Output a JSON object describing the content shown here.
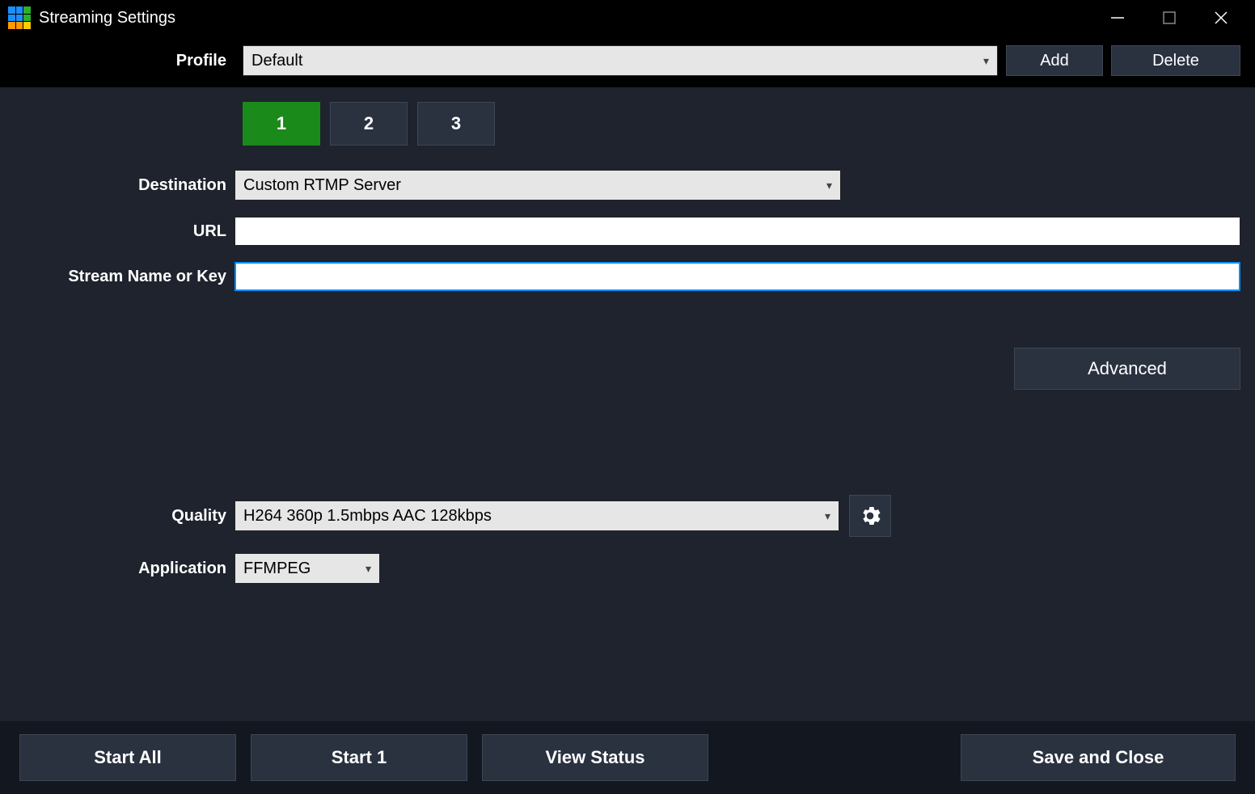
{
  "window": {
    "title": "Streaming Settings"
  },
  "profile": {
    "label": "Profile",
    "value": "Default",
    "add": "Add",
    "delete": "Delete"
  },
  "tabs": [
    "1",
    "2",
    "3"
  ],
  "destination": {
    "label": "Destination",
    "value": "Custom RTMP Server"
  },
  "url": {
    "label": "URL",
    "value": ""
  },
  "streamkey": {
    "label": "Stream Name or Key",
    "value": ""
  },
  "advanced": "Advanced",
  "quality": {
    "label": "Quality",
    "value": "H264 360p 1.5mbps AAC 128kbps"
  },
  "application": {
    "label": "Application",
    "value": "FFMPEG"
  },
  "footer": {
    "startall": "Start All",
    "start1": "Start 1",
    "viewstatus": "View Status",
    "save": "Save and Close"
  }
}
